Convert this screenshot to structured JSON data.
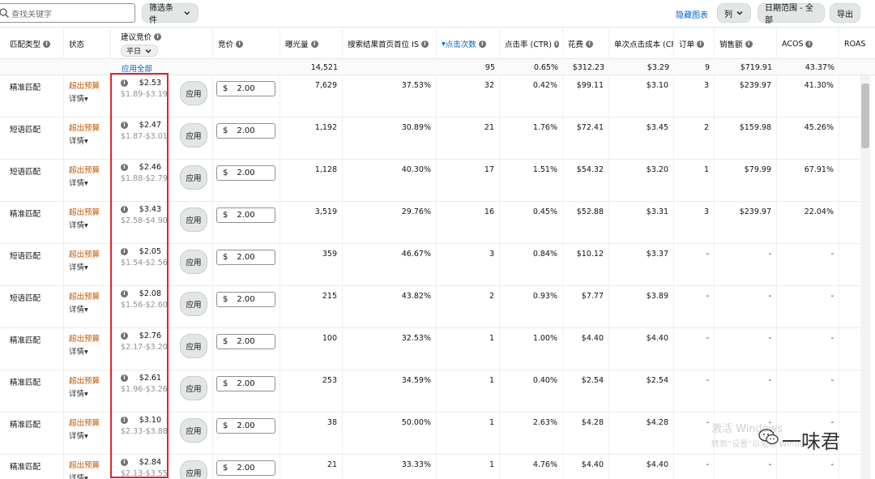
{
  "toolbar": {
    "search_placeholder": "查找关键字",
    "filter_label": "筛选条件",
    "hide_chart_label": "隐藏图表",
    "columns_label": "列",
    "date_range_label": "日期范围 - 全部",
    "export_label": "导出"
  },
  "headers": {
    "match_type": "匹配类型",
    "status": "状态",
    "suggested_bid": "建议竞价",
    "period": "平日",
    "bid": "竞价",
    "impressions": "曝光量",
    "top_of_search": "搜索结果首页首位 IS",
    "clicks": "点击次数",
    "ctr": "点击率 (CTR)",
    "spend": "花费",
    "cpc": "单次点击成本 (CPC)",
    "orders": "订单",
    "sales": "销售额",
    "acos": "ACOS",
    "roas": "ROAS"
  },
  "totals": {
    "apply_all": "应用全部",
    "impressions": "14,521",
    "clicks": "95",
    "ctr": "0.65%",
    "spend": "$312.23",
    "cpc": "$3.29",
    "orders": "9",
    "sales": "$719.91",
    "acos": "43.37%"
  },
  "labels": {
    "over_budget": "超出预算",
    "details": "详情",
    "apply": "应用",
    "currency": "$"
  },
  "rows": [
    {
      "match": "精准匹配",
      "sugg": "$2.53",
      "range": "$1.89-$3.19",
      "bid": "2.00",
      "impressions": "7,629",
      "tos": "37.53%",
      "clicks": "32",
      "ctr": "0.42%",
      "spend": "$99.11",
      "cpc": "$3.10",
      "orders": "3",
      "sales": "$239.97",
      "acos": "41.30%"
    },
    {
      "match": "短语匹配",
      "sugg": "$2.47",
      "range": "$1.87-$3.01",
      "bid": "2.00",
      "impressions": "1,192",
      "tos": "30.89%",
      "clicks": "21",
      "ctr": "1.76%",
      "spend": "$72.41",
      "cpc": "$3.45",
      "orders": "2",
      "sales": "$159.98",
      "acos": "45.26%"
    },
    {
      "match": "短语匹配",
      "sugg": "$2.46",
      "range": "$1.88-$2.79",
      "bid": "2.00",
      "impressions": "1,128",
      "tos": "40.30%",
      "clicks": "17",
      "ctr": "1.51%",
      "spend": "$54.32",
      "cpc": "$3.20",
      "orders": "1",
      "sales": "$79.99",
      "acos": "67.91%"
    },
    {
      "match": "精准匹配",
      "sugg": "$3.43",
      "range": "$2.58-$4.90",
      "bid": "2.00",
      "impressions": "3,519",
      "tos": "29.76%",
      "clicks": "16",
      "ctr": "0.45%",
      "spend": "$52.88",
      "cpc": "$3.31",
      "orders": "3",
      "sales": "$239.97",
      "acos": "22.04%"
    },
    {
      "match": "短语匹配",
      "sugg": "$2.05",
      "range": "$1.54-$2.56",
      "bid": "2.00",
      "impressions": "359",
      "tos": "46.67%",
      "clicks": "3",
      "ctr": "0.84%",
      "spend": "$10.12",
      "cpc": "$3.37",
      "orders": "-",
      "sales": "-",
      "acos": "-"
    },
    {
      "match": "短语匹配",
      "sugg": "$2.08",
      "range": "$1.56-$2.60",
      "bid": "2.00",
      "impressions": "215",
      "tos": "43.82%",
      "clicks": "2",
      "ctr": "0.93%",
      "spend": "$7.77",
      "cpc": "$3.89",
      "orders": "-",
      "sales": "-",
      "acos": "-"
    },
    {
      "match": "精准匹配",
      "sugg": "$2.76",
      "range": "$2.17-$3.20",
      "bid": "2.00",
      "impressions": "100",
      "tos": "32.53%",
      "clicks": "1",
      "ctr": "1.00%",
      "spend": "$4.40",
      "cpc": "$4.40",
      "orders": "-",
      "sales": "-",
      "acos": "-"
    },
    {
      "match": "精准匹配",
      "sugg": "$2.61",
      "range": "$1.96-$3.26",
      "bid": "2.00",
      "impressions": "253",
      "tos": "34.59%",
      "clicks": "1",
      "ctr": "0.40%",
      "spend": "$2.54",
      "cpc": "$2.54",
      "orders": "-",
      "sales": "-",
      "acos": "-"
    },
    {
      "match": "精准匹配",
      "sugg": "$3.10",
      "range": "$2.33-$3.88",
      "bid": "2.00",
      "impressions": "38",
      "tos": "50.00%",
      "clicks": "1",
      "ctr": "2.63%",
      "spend": "$4.28",
      "cpc": "$4.28",
      "orders": "-",
      "sales": "-",
      "acos": "-"
    },
    {
      "match": "精准匹配",
      "sugg": "$2.84",
      "range": "$2.13-$3.55",
      "bid": "2.00",
      "impressions": "21",
      "tos": "33.33%",
      "clicks": "1",
      "ctr": "4.76%",
      "spend": "$4.40",
      "cpc": "$4.40",
      "orders": "-",
      "sales": "-",
      "acos": "-"
    }
  ],
  "watermark": {
    "line1": "激活 Windows",
    "line2": "转到“设置”以激活 Windows。",
    "author": "一味君"
  },
  "colors": {
    "link": "#0066c0",
    "over_budget": "#c45500",
    "highlight_box": "#e0232e"
  }
}
